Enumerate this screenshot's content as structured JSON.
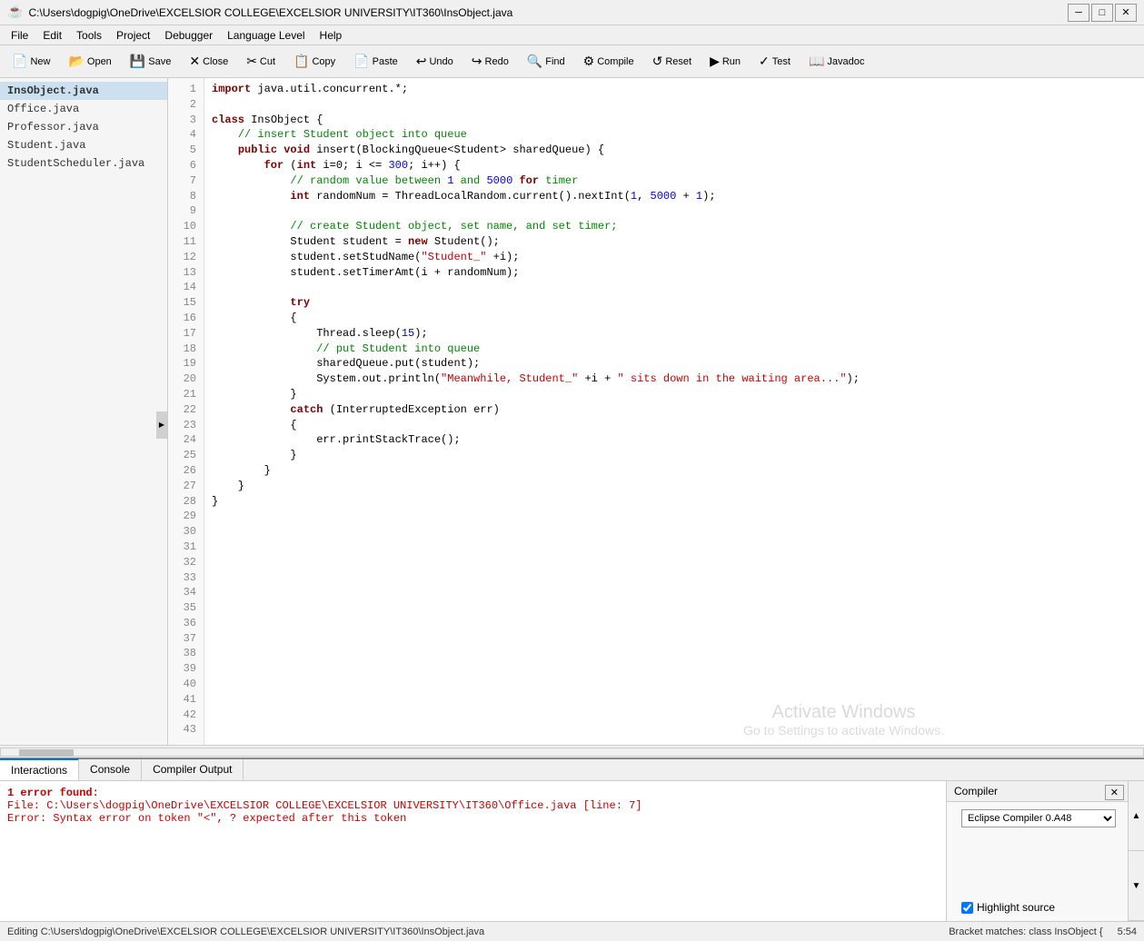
{
  "titlebar": {
    "icon": "☕",
    "path": "C:\\Users\\dogpig\\OneDrive\\EXCELSIOR COLLEGE\\EXCELSIOR UNIVERSITY\\IT360\\InsObject.java",
    "minimize": "─",
    "maximize": "□",
    "close": "✕"
  },
  "menubar": {
    "items": [
      "File",
      "Edit",
      "Tools",
      "Project",
      "Debugger",
      "Language Level",
      "Help"
    ]
  },
  "toolbar": {
    "buttons": [
      {
        "icon": "📄",
        "label": "New"
      },
      {
        "icon": "📂",
        "label": "Open"
      },
      {
        "icon": "💾",
        "label": "Save"
      },
      {
        "icon": "✕",
        "label": "Close"
      },
      {
        "icon": "✂",
        "label": "Cut"
      },
      {
        "icon": "📋",
        "label": "Copy"
      },
      {
        "icon": "📄",
        "label": "Paste"
      },
      {
        "icon": "↩",
        "label": "Undo"
      },
      {
        "icon": "↪",
        "label": "Redo"
      },
      {
        "icon": "🔍",
        "label": "Find"
      },
      {
        "icon": "⚙",
        "label": "Compile"
      },
      {
        "icon": "↺",
        "label": "Reset"
      },
      {
        "icon": "▶",
        "label": "Run"
      },
      {
        "icon": "✓",
        "label": "Test"
      },
      {
        "icon": "📖",
        "label": "Javadoc"
      }
    ]
  },
  "files": {
    "items": [
      {
        "name": "InsObject.java",
        "active": true
      },
      {
        "name": "Office.java",
        "active": false
      },
      {
        "name": "Professor.java",
        "active": false
      },
      {
        "name": "Student.java",
        "active": false
      },
      {
        "name": "StudentScheduler.java",
        "active": false
      }
    ]
  },
  "code": {
    "lines": [
      {
        "num": 1,
        "text": "import java.util.concurrent.*;"
      },
      {
        "num": 2,
        "text": ""
      },
      {
        "num": 3,
        "text": "class InsObject {"
      },
      {
        "num": 4,
        "text": "    // insert Student object into queue"
      },
      {
        "num": 5,
        "text": "    public void insert(BlockingQueue<Student> sharedQueue) {"
      },
      {
        "num": 6,
        "text": "        for (int i=0; i <= 300; i++) {"
      },
      {
        "num": 7,
        "text": "            // random value between 1 and 5000 for timer"
      },
      {
        "num": 8,
        "text": "            int randomNum = ThreadLocalRandom.current().nextInt(1, 5000 + 1);"
      },
      {
        "num": 9,
        "text": ""
      },
      {
        "num": 10,
        "text": "            // create Student object, set name, and set timer;"
      },
      {
        "num": 11,
        "text": "            Student student = new Student();"
      },
      {
        "num": 12,
        "text": "            student.setStudName(\"Student_\" +i);"
      },
      {
        "num": 13,
        "text": "            student.setTimerAmt(i + randomNum);"
      },
      {
        "num": 14,
        "text": ""
      },
      {
        "num": 15,
        "text": "            try"
      },
      {
        "num": 16,
        "text": "            {"
      },
      {
        "num": 17,
        "text": "                Thread.sleep(15);"
      },
      {
        "num": 18,
        "text": "                // put Student into queue"
      },
      {
        "num": 19,
        "text": "                sharedQueue.put(student);"
      },
      {
        "num": 20,
        "text": "                System.out.println(\"Meanwhile, Student_\" +i + \" sits down in the waiting area...\");"
      },
      {
        "num": 21,
        "text": "            }"
      },
      {
        "num": 22,
        "text": "            catch (InterruptedException err)"
      },
      {
        "num": 23,
        "text": "            {"
      },
      {
        "num": 24,
        "text": "                err.printStackTrace();"
      },
      {
        "num": 25,
        "text": "            }"
      },
      {
        "num": 26,
        "text": "        }"
      },
      {
        "num": 27,
        "text": "    }"
      },
      {
        "num": 28,
        "text": "}"
      },
      {
        "num": 29,
        "text": ""
      },
      {
        "num": 30,
        "text": ""
      },
      {
        "num": 31,
        "text": ""
      },
      {
        "num": 32,
        "text": ""
      },
      {
        "num": 33,
        "text": ""
      },
      {
        "num": 34,
        "text": ""
      },
      {
        "num": 35,
        "text": ""
      },
      {
        "num": 36,
        "text": ""
      },
      {
        "num": 37,
        "text": ""
      },
      {
        "num": 38,
        "text": ""
      },
      {
        "num": 39,
        "text": ""
      },
      {
        "num": 40,
        "text": ""
      },
      {
        "num": 41,
        "text": ""
      },
      {
        "num": 42,
        "text": ""
      },
      {
        "num": 43,
        "text": ""
      }
    ]
  },
  "bottom": {
    "tabs": [
      "Interactions",
      "Console",
      "Compiler Output"
    ],
    "active_tab": "Interactions",
    "error_count": "1 error found:",
    "error_file": "File: C:\\Users\\dogpig\\OneDrive\\EXCELSIOR COLLEGE\\EXCELSIOR UNIVERSITY\\IT360\\Office.java  [line: 7]",
    "error_msg": "Error: Syntax error on token \"<\", ? expected after this token",
    "compiler_label": "Compiler",
    "compiler_value": "Eclipse Compiler 0.A48",
    "highlight_label": "Highlight source",
    "highlight_checked": true
  },
  "statusbar": {
    "left": "Editing C:\\Users\\dogpig\\OneDrive\\EXCELSIOR COLLEGE\\EXCELSIOR UNIVERSITY\\IT360\\InsObject.java",
    "right": "Bracket matches: class InsObject {",
    "time": "5:54"
  },
  "watermark": {
    "line1": "Activate Windows",
    "line2": "Go to Settings to activate Windows."
  }
}
